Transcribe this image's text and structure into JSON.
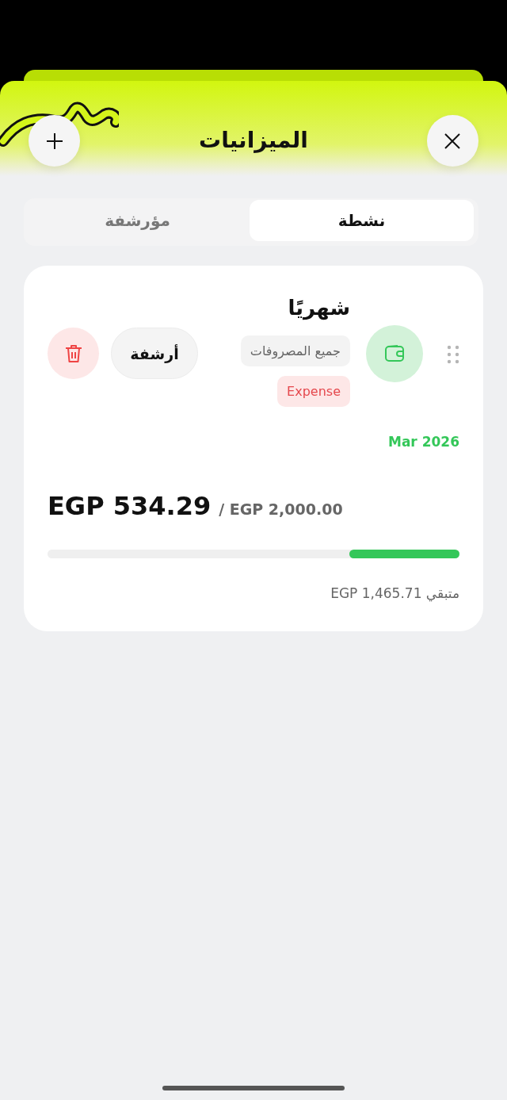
{
  "header": {
    "title": "الميزانيات"
  },
  "tabs": [
    {
      "label": "نشطة",
      "selected": true
    },
    {
      "label": "مؤرشفة",
      "selected": false
    }
  ],
  "budget": {
    "name": "شهريًا",
    "category": "جميع المصروفات",
    "type_tag": "Expense",
    "archive_label": "أرشفة",
    "period": "Mar 2026",
    "spent": "EGP 534.29",
    "limit": "/ EGP 2,000.00",
    "level": 0.267,
    "remaining": "متبقي EGP 1,465.71"
  }
}
